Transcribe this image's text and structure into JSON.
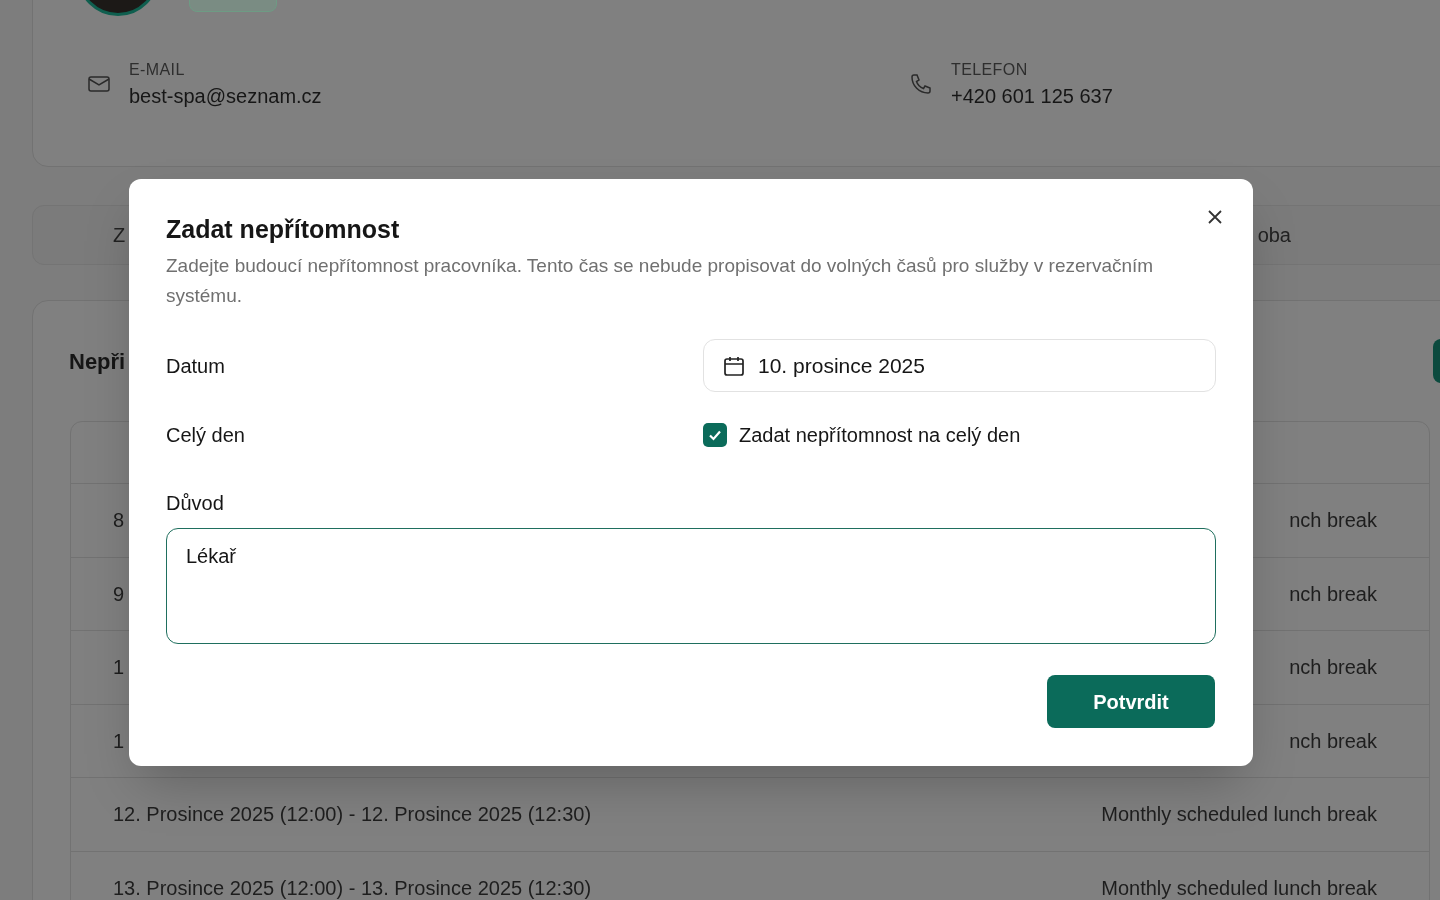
{
  "profile": {
    "email": {
      "label": "E-MAIL",
      "value": "best-spa@seznam.cz"
    },
    "phone": {
      "label": "TELEFON",
      "value": "+420 601 125 637"
    }
  },
  "tabs": [
    {
      "label": "Z"
    },
    {
      "label": "oba"
    }
  ],
  "absences": {
    "title": "Nepři",
    "rows": [
      {
        "period": "8",
        "reason": "nch break"
      },
      {
        "period": "9",
        "reason": "nch break"
      },
      {
        "period": "1",
        "reason": "nch break"
      },
      {
        "period": "1",
        "reason": "nch break"
      },
      {
        "period": "12. Prosince 2025 (12:00) - 12. Prosince 2025 (12:30)",
        "reason": "Monthly scheduled lunch break"
      },
      {
        "period": "13. Prosince 2025 (12:00) - 13. Prosince 2025 (12:30)",
        "reason": "Monthly scheduled lunch break"
      }
    ]
  },
  "dialog": {
    "title": "Zadat nepřítomnost",
    "description": "Zadejte budoucí nepřítomnost pracovníka. Tento čas se nebude propisovat do volných časů pro služby v rezervačním systému.",
    "date": {
      "label": "Datum",
      "value": "10. prosince 2025"
    },
    "all_day": {
      "label": "Celý den",
      "option": "Zadat nepřítomnost na celý den",
      "checked": true
    },
    "reason": {
      "label": "Důvod",
      "value": "Lékař"
    },
    "confirm": "Potvrdit"
  }
}
